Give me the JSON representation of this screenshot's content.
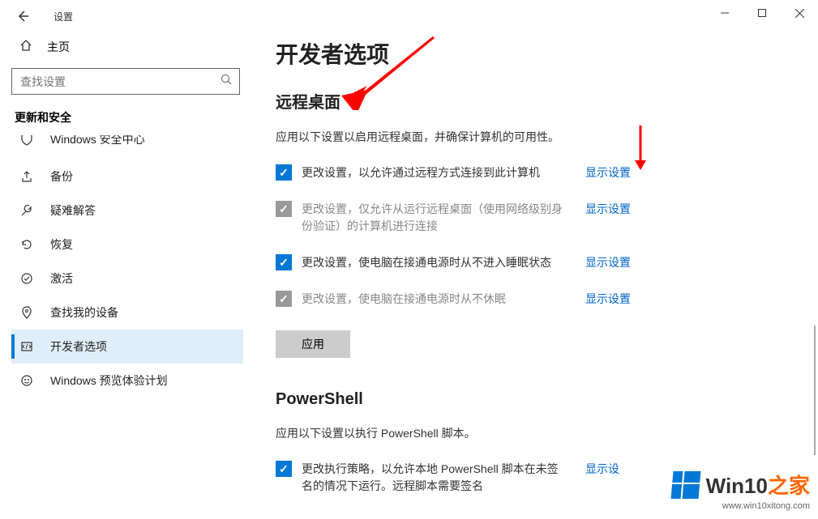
{
  "titlebar": {
    "app_name": "设置"
  },
  "sidebar": {
    "home_label": "主页",
    "search_placeholder": "查找设置",
    "section_title": "更新和安全",
    "items": [
      {
        "label": "Windows 安全中心",
        "icon": "shield"
      },
      {
        "label": "备份",
        "icon": "backup"
      },
      {
        "label": "疑难解答",
        "icon": "troubleshoot"
      },
      {
        "label": "恢复",
        "icon": "recovery"
      },
      {
        "label": "激活",
        "icon": "activation"
      },
      {
        "label": "查找我的设备",
        "icon": "find-device"
      },
      {
        "label": "开发者选项",
        "icon": "developer"
      },
      {
        "label": "Windows 预览体验计划",
        "icon": "insider"
      }
    ]
  },
  "main": {
    "page_title": "开发者选项",
    "section_remote": {
      "title": "远程桌面",
      "desc": "应用以下设置以启用远程桌面，并确保计算机的可用性。",
      "rows": [
        {
          "text": "更改设置，以允许通过远程方式连接到此计算机",
          "checked": true,
          "disabled": false,
          "link": "显示设置"
        },
        {
          "text": "更改设置，仅允许从运行远程桌面（使用网络级别身份验证）的计算机进行连接",
          "checked": true,
          "disabled": true,
          "link": "显示设置"
        },
        {
          "text": "更改设置，使电脑在接通电源时从不进入睡眠状态",
          "checked": true,
          "disabled": false,
          "link": "显示设置"
        },
        {
          "text": "更改设置，使电脑在接通电源时从不休眠",
          "checked": true,
          "disabled": true,
          "link": "显示设置"
        }
      ],
      "apply_label": "应用"
    },
    "section_powershell": {
      "title": "PowerShell",
      "desc": "应用以下设置以执行 PowerShell 脚本。",
      "rows": [
        {
          "text": "更改执行策略，以允许本地 PowerShell 脚本在未签名的情况下运行。远程脚本需要签名",
          "checked": true,
          "disabled": false,
          "link": "显示设"
        }
      ]
    }
  },
  "watermark": {
    "brand_prefix": "Win10",
    "brand_suffix": "之家",
    "url": "www.win10xitong.com"
  }
}
